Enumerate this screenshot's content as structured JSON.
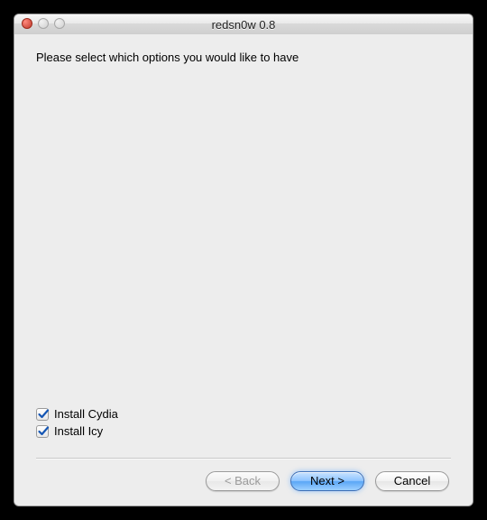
{
  "window": {
    "title": "redsn0w 0.8"
  },
  "prompt": "Please select which options you would like to have",
  "options": [
    {
      "label": "Install Cydia",
      "checked": true
    },
    {
      "label": "Install Icy",
      "checked": true
    }
  ],
  "buttons": {
    "back": "< Back",
    "next": "Next >",
    "cancel": "Cancel"
  }
}
